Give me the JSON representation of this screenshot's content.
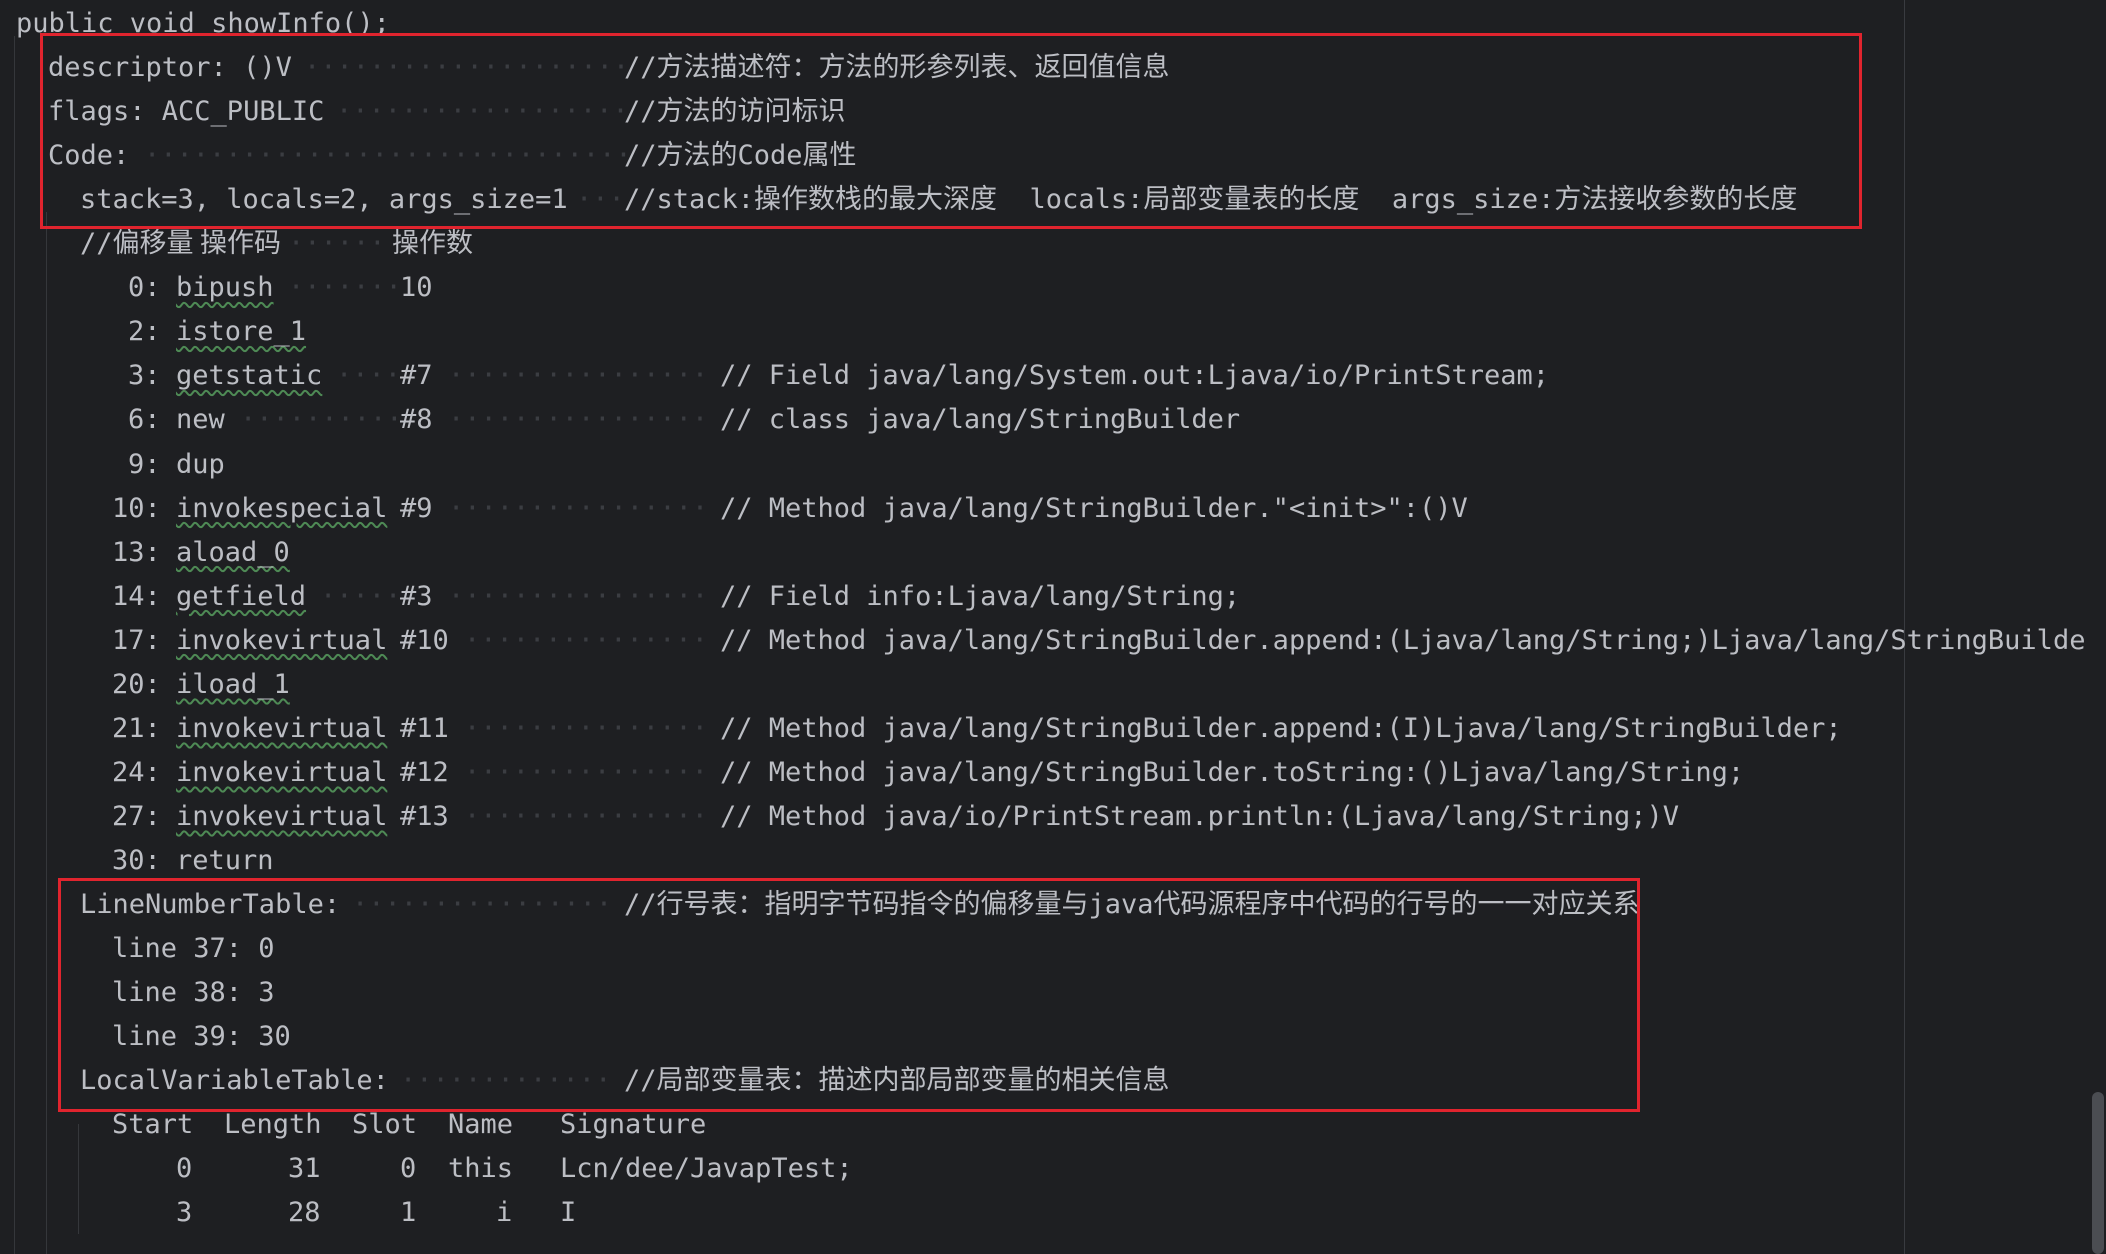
{
  "header": "public void showInfo();",
  "meta": {
    "descriptor": {
      "code": "descriptor: ()V",
      "comment": "//方法描述符：方法的形参列表、返回值信息"
    },
    "flags": {
      "code": "flags: ACC_PUBLIC",
      "comment": "//方法的访问标识"
    },
    "code": {
      "code": "Code:",
      "comment": "//方法的Code属性"
    },
    "stack": {
      "code": "stack=3, locals=2, args_size=1",
      "comment": "//stack:操作数栈的最大深度  locals:局部变量表的长度  args_size:方法接收参数的长度"
    }
  },
  "instructions_header": {
    "offset": "//偏移量",
    "opcode": "操作码",
    "operand": "操作数"
  },
  "instructions": [
    {
      "offset": "0:",
      "opcode": "bipush",
      "operand": "10",
      "comment": ""
    },
    {
      "offset": "2:",
      "opcode": "istore_1",
      "operand": "",
      "comment": ""
    },
    {
      "offset": "3:",
      "opcode": "getstatic",
      "operand": "#7",
      "comment": "// Field java/lang/System.out:Ljava/io/PrintStream;"
    },
    {
      "offset": "6:",
      "opcode": "new",
      "operand": "#8",
      "comment": "// class java/lang/StringBuilder"
    },
    {
      "offset": "9:",
      "opcode": "dup",
      "operand": "",
      "comment": ""
    },
    {
      "offset": "10:",
      "opcode": "invokespecial",
      "operand": "#9",
      "comment": "// Method java/lang/StringBuilder.\"<init>\":()V"
    },
    {
      "offset": "13:",
      "opcode": "aload_0",
      "operand": "",
      "comment": ""
    },
    {
      "offset": "14:",
      "opcode": "getfield",
      "operand": "#3",
      "comment": "// Field info:Ljava/lang/String;"
    },
    {
      "offset": "17:",
      "opcode": "invokevirtual",
      "operand": "#10",
      "comment": "// Method java/lang/StringBuilder.append:(Ljava/lang/String;)Ljava/lang/StringBuilder;"
    },
    {
      "offset": "20:",
      "opcode": "iload_1",
      "operand": "",
      "comment": ""
    },
    {
      "offset": "21:",
      "opcode": "invokevirtual",
      "operand": "#11",
      "comment": "// Method java/lang/StringBuilder.append:(I)Ljava/lang/StringBuilder;"
    },
    {
      "offset": "24:",
      "opcode": "invokevirtual",
      "operand": "#12",
      "comment": "// Method java/lang/StringBuilder.toString:()Ljava/lang/String;"
    },
    {
      "offset": "27:",
      "opcode": "invokevirtual",
      "operand": "#13",
      "comment": "// Method java/io/PrintStream.println:(Ljava/lang/String;)V"
    },
    {
      "offset": "30:",
      "opcode": "return",
      "operand": "",
      "comment": ""
    }
  ],
  "line_number_table": {
    "label": "LineNumberTable:",
    "comment": "//行号表：指明字节码指令的偏移量与java代码源程序中代码的行号的一一对应关系",
    "entries": [
      "line 37: 0",
      "line 38: 3",
      "line 39: 30"
    ]
  },
  "local_variable_table": {
    "label": "LocalVariableTable:",
    "comment": "//局部变量表：描述内部局部变量的相关信息",
    "columns": [
      "Start",
      "Length",
      "Slot",
      "Name",
      "Signature"
    ],
    "rows": [
      [
        "0",
        "31",
        "0",
        "this",
        "Lcn/dee/JavapTest;"
      ],
      [
        "3",
        "28",
        "1",
        "i",
        "I"
      ]
    ]
  }
}
